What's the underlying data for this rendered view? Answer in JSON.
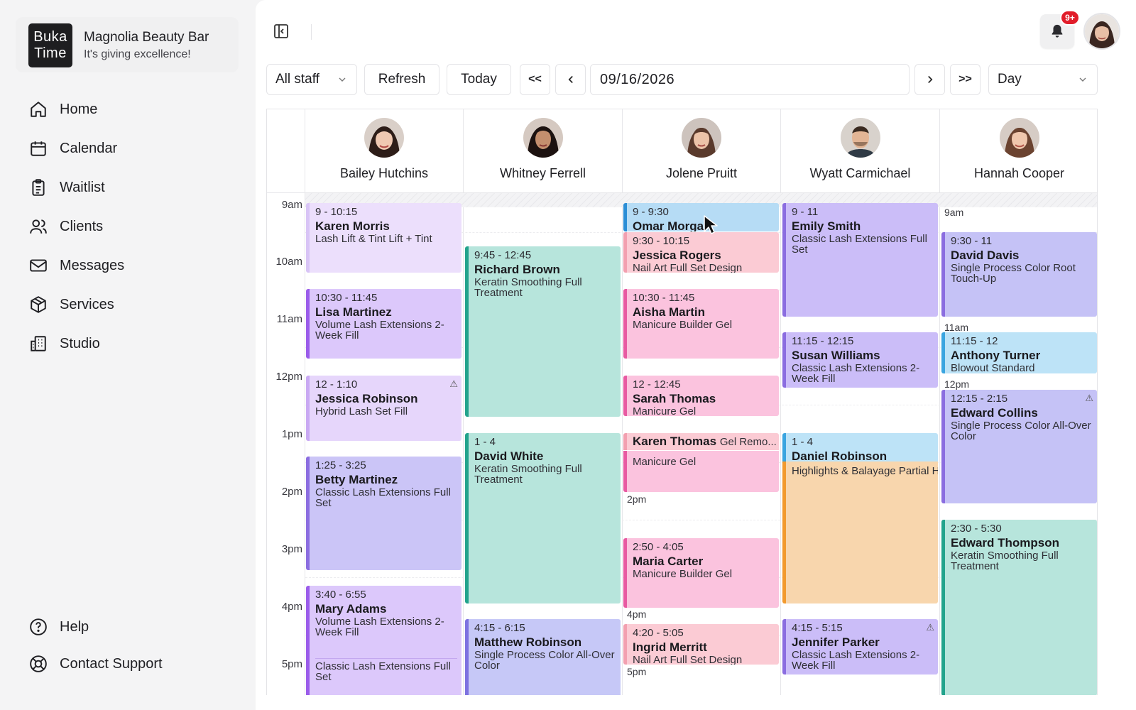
{
  "sidebar": {
    "logo_line1": "Buka",
    "logo_line2": "Time",
    "brand_name": "Magnolia Beauty Bar",
    "brand_tagline": "It's giving excellence!",
    "items": [
      {
        "label": "Home",
        "icon": "home-icon"
      },
      {
        "label": "Calendar",
        "icon": "calendar-icon"
      },
      {
        "label": "Waitlist",
        "icon": "clipboard-icon"
      },
      {
        "label": "Clients",
        "icon": "users-icon"
      },
      {
        "label": "Messages",
        "icon": "mail-icon"
      },
      {
        "label": "Services",
        "icon": "box-icon"
      },
      {
        "label": "Studio",
        "icon": "building-icon"
      }
    ],
    "footer_items": [
      {
        "label": "Help",
        "icon": "help-icon"
      },
      {
        "label": "Contact Support",
        "icon": "lifebuoy-icon"
      }
    ]
  },
  "topbar": {
    "notification_badge": "9+"
  },
  "toolbar": {
    "staff_filter": "All staff",
    "refresh": "Refresh",
    "today": "Today",
    "first": "<<",
    "prev": "<",
    "date": "09/16/2026",
    "next": ">",
    "last": ">>",
    "view": "Day"
  },
  "staff": [
    {
      "name": "Bailey Hutchins"
    },
    {
      "name": "Whitney Ferrell"
    },
    {
      "name": "Jolene Pruitt"
    },
    {
      "name": "Wyatt Carmichael"
    },
    {
      "name": "Hannah Cooper"
    }
  ],
  "time_labels": [
    "9am",
    "10am",
    "11am",
    "12pm",
    "1pm",
    "2pm",
    "3pm",
    "4pm",
    "5pm"
  ],
  "inline_times": {
    "hannah_9am": "9am",
    "hannah_11am": "11am",
    "hannah_12pm": "12pm",
    "jolene_2pm": "2pm",
    "jolene_4pm": "4pm",
    "jolene_5pm": "5pm"
  },
  "appointments": {
    "bailey": [
      {
        "time": "9 - 10:15",
        "name": "Karen Morris",
        "service": "Lash Lift & Tint Lift + Tint"
      },
      {
        "time": "10:30 - 11:45",
        "name": "Lisa Martinez",
        "service": "Volume Lash Extensions 2-Week Fill"
      },
      {
        "time": "12 - 1:10",
        "name": "Jessica Robinson",
        "service": "Hybrid Lash Set Fill",
        "warning": "⚠"
      },
      {
        "time": "1:25 - 3:25",
        "name": "Betty Martinez",
        "service": "Classic Lash Extensions Full Set"
      },
      {
        "time": "3:40 - 6:55",
        "name": "Mary Adams",
        "service": "Volume Lash Extensions 2-Week Fill",
        "service2": "Classic Lash Extensions Full Set"
      }
    ],
    "whitney": [
      {
        "time": "9:45 - 12:45",
        "name": "Richard Brown",
        "service": "Keratin Smoothing Full Treatment"
      },
      {
        "time": "1 - 4",
        "name": "David White",
        "service": "Keratin Smoothing Full Treatment"
      },
      {
        "time": "4:15 - 6:15",
        "name": "Matthew Robinson",
        "service": "Single Process Color All-Over Color"
      }
    ],
    "jolene": [
      {
        "time": "9 - 9:30",
        "name": "Omar Morgan"
      },
      {
        "time": "9:30 - 10:15",
        "name": "Jessica Rogers",
        "service": "Nail Art Full Set Design"
      },
      {
        "time": "10:30 - 11:45",
        "name": "Aisha Martin",
        "service": "Manicure Builder Gel"
      },
      {
        "time": "12 - 12:45",
        "name": "Sarah Thomas",
        "service": "Manicure Gel"
      },
      {
        "name": "Karen Thomas",
        "extra": "Gel Remo...",
        "service": "Manicure Gel"
      },
      {
        "time": "2:50 - 4:05",
        "name": "Maria Carter",
        "service": "Manicure Builder Gel"
      },
      {
        "time": "4:20 - 5:05",
        "name": "Ingrid Merritt",
        "service": "Nail Art Full Set Design"
      }
    ],
    "wyatt": [
      {
        "time": "9 - 11",
        "name": "Emily Smith",
        "service": "Classic Lash Extensions Full Set"
      },
      {
        "time": "11:15 - 12:15",
        "name": "Susan Williams",
        "service": "Classic Lash Extensions 2-Week Fill"
      },
      {
        "time": "1 - 4",
        "name": "Daniel Robinson",
        "service": "Highlights & Balayage Partial H"
      },
      {
        "time": "4:15 - 5:15",
        "name": "Jennifer Parker",
        "service": "Classic Lash Extensions 2-Week Fill",
        "warning": "⚠"
      }
    ],
    "hannah": [
      {
        "time": "9:30 - 11",
        "name": "David Davis",
        "service": "Single Process Color Root Touch-Up"
      },
      {
        "time": "11:15 - 12",
        "name": "Anthony Turner",
        "service": "Blowout Standard"
      },
      {
        "time": "12:15 - 2:15",
        "name": "Edward Collins",
        "service": "Single Process Color All-Over Color",
        "warning": "⚠"
      },
      {
        "time": "2:30 - 5:30",
        "name": "Edward Thompson",
        "service": "Keratin Smoothing Full Treatment"
      }
    ]
  }
}
